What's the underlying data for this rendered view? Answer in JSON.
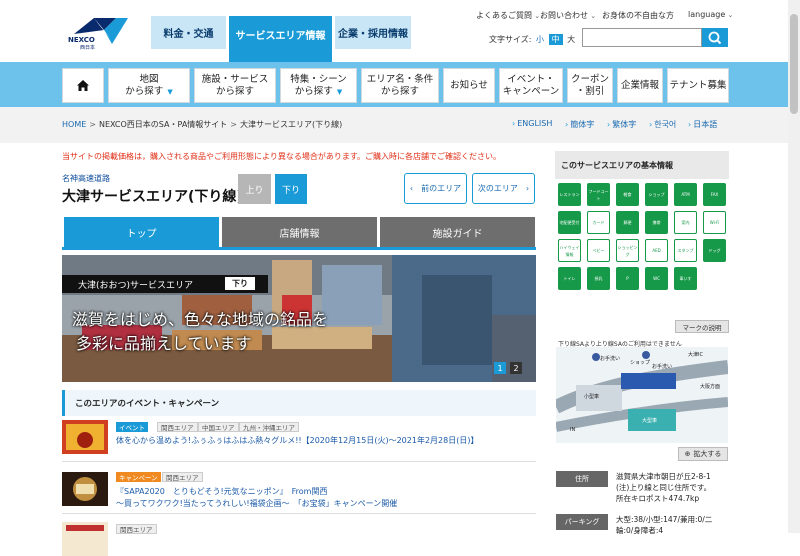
{
  "header": {
    "logo_text": "NEXCO",
    "logo_sub": "西日本",
    "tabs": [
      {
        "label": "料金・交通"
      },
      {
        "label": "サービスエリア情報"
      },
      {
        "label": "企業・採用情報"
      }
    ],
    "util_links": [
      {
        "label": "よくあるご質問"
      },
      {
        "label": "お問い合わせ"
      },
      {
        "label": "お身体の不自由な方"
      },
      {
        "label": "language"
      }
    ],
    "font_size_label": "文字サイズ:",
    "font_sizes": [
      "小",
      "中",
      "大"
    ],
    "search_placeholder": ""
  },
  "nav": [
    {
      "line1": "地図",
      "line2": "から探す"
    },
    {
      "line1": "施設・サービス",
      "line2": "から探す"
    },
    {
      "line1": "特集・シーン",
      "line2": "から探す"
    },
    {
      "line1": "エリア名・条件",
      "line2": "から探す"
    },
    {
      "line1": "お知らせ",
      "line2": ""
    },
    {
      "line1": "イベント・",
      "line2": "キャンペーン"
    },
    {
      "line1": "クーポン",
      "line2": "・割引"
    },
    {
      "line1": "企業情報",
      "line2": ""
    },
    {
      "line1": "テナント募集",
      "line2": ""
    }
  ],
  "breadcrumb": [
    "HOME",
    "NEXCO西日本のSA・PA情報サイト",
    "大津サービスエリア(下り線)"
  ],
  "languages": [
    "ENGLISH",
    "簡体字",
    "繁体字",
    "한국어",
    "日本語"
  ],
  "notice": "当サイトの掲載価格は，購入される商品やご利用形態により異なる場合があります。ご購入時に各店舗でご確認ください。",
  "road": "名神高速道路",
  "page_title": "大津サービスエリア(下り線)",
  "direction": {
    "up": "上り",
    "down": "下り"
  },
  "area_nav": {
    "prev": "前のエリア",
    "next": "次のエリア"
  },
  "page_tabs": [
    {
      "label": "トップ"
    },
    {
      "label": "店舗情報"
    },
    {
      "label": "施設ガイド"
    }
  ],
  "hero": {
    "title": "大津(おおつ)サービスエリア",
    "tag": "下り",
    "copy_line1": "滋賀をはじめ、色々な地域の銘品を",
    "copy_line2": "多彩に品揃えしています",
    "pages": [
      "1",
      "2"
    ]
  },
  "events": {
    "heading": "このエリアのイベント・キャンペーン",
    "items": [
      {
        "badges": [
          "イベント",
          "関西エリア",
          "中国エリア",
          "九州・沖縄エリア"
        ],
        "title": "体を心から温めよう!ふぅふぅはふはふ熱々グルメ!!【2020年12月15日(火)〜2021年2月28日(日)】"
      },
      {
        "badges": [
          "キャンペーン",
          "関西エリア"
        ],
        "title": "『SAPA2020　とりもどそう!元気なニッポン』　From関西",
        "title2": "〜買ってワクワク!当たってうれしい!福袋企画〜　「お宝袋」キャンペーン開催"
      },
      {
        "badges": [
          "関西エリア"
        ],
        "title": ""
      }
    ]
  },
  "sidebar": {
    "heading": "このサービスエリアの基本情報",
    "facilities": [
      "レストラン",
      "フードコート",
      "軽食",
      "ショップ",
      "ATM",
      "FAX",
      "宅配便受付",
      "カード",
      "郵便",
      "携帯",
      "案内",
      "Wi-Fi",
      "ハイウェイ情報",
      "ベビー",
      "ショッピング",
      "AED",
      "スタンプ",
      "ドッグ",
      "トイレ",
      "授乳",
      "P",
      "WC",
      "車いす"
    ],
    "mark_button": "マークの説明",
    "map_note": "下り線SAより上り線SAのご利用はできません",
    "map_labels": [
      "お手洗い",
      "ショップ",
      "大津IC",
      "小型車",
      "大型車",
      "IN",
      "お手洗い",
      "大阪方面"
    ],
    "zoom_button": "拡大する",
    "address_label": "住所",
    "address_line1": "滋賀県大津市朝日が丘2-8-1",
    "address_line2": "(注)上り線と同じ住所です。",
    "address_line3": "所在キロポスト474.7kp",
    "parking_label": "パーキング",
    "parking_line1": "大型:38/小型:147/兼用:0/二",
    "parking_line2": "輪:0/身障者:4"
  }
}
